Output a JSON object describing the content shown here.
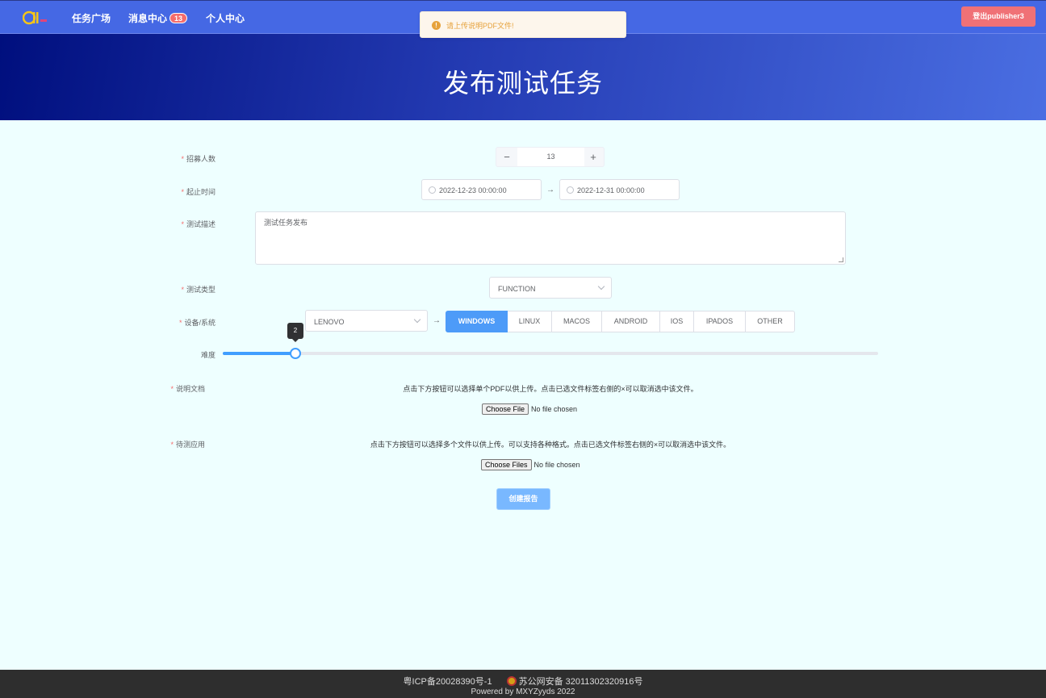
{
  "nav": {
    "items": [
      {
        "label": "任务广场"
      },
      {
        "label": "消息中心",
        "badge": "13"
      },
      {
        "label": "个人中心"
      }
    ],
    "logout_label": "登出publisher3",
    "logo_icon": "logo-icon",
    "colors": {
      "bar": "#4568e4",
      "logout": "#f07176"
    }
  },
  "toast": {
    "message": "请上传说明PDF文件!",
    "icon": "warning-icon",
    "color": "#e6a23c"
  },
  "banner": {
    "title": "发布测试任务"
  },
  "form": {
    "recruit": {
      "label": "招募人数",
      "value": "13",
      "minus": "−",
      "plus": "+"
    },
    "period": {
      "label": "起止时间",
      "start": "2022-12-23 00:00:00",
      "end": "2022-12-31 00:00:00",
      "separator": "→"
    },
    "description": {
      "label": "测试描述",
      "value": "测试任务发布"
    },
    "test_type": {
      "label": "测试类型",
      "value": "FUNCTION"
    },
    "device": {
      "label": "设备/系统",
      "value": "LENOVO",
      "separator": "→",
      "os_options": [
        "WINDOWS",
        "LINUX",
        "MACOS",
        "ANDROID",
        "IOS",
        "IPADOS",
        "OTHER"
      ],
      "os_selected": "WINDOWS"
    },
    "difficulty": {
      "label": "难度",
      "value": 2,
      "tooltip": "2",
      "fill_fraction": 0.111
    },
    "doc": {
      "label": "说明文档",
      "hint": "点击下方按钮可以选择单个PDF以供上传。点击已选文件标签右侧的×可以取消选中该文件。",
      "button": "Choose File",
      "status": "No file chosen"
    },
    "app": {
      "label": "待测应用",
      "hint": "点击下方按钮可以选择多个文件以供上传。可以支持各种格式。点击已选文件标签右侧的×可以取消选中该文件。",
      "button": "Choose Files",
      "status": "No file chosen"
    },
    "submit_label": "创建报告"
  },
  "footer": {
    "icp": "粤ICP备20028390号-1",
    "police": "苏公网安备 32011302320916号",
    "powered": "Powered by MXYZyyds 2022"
  }
}
